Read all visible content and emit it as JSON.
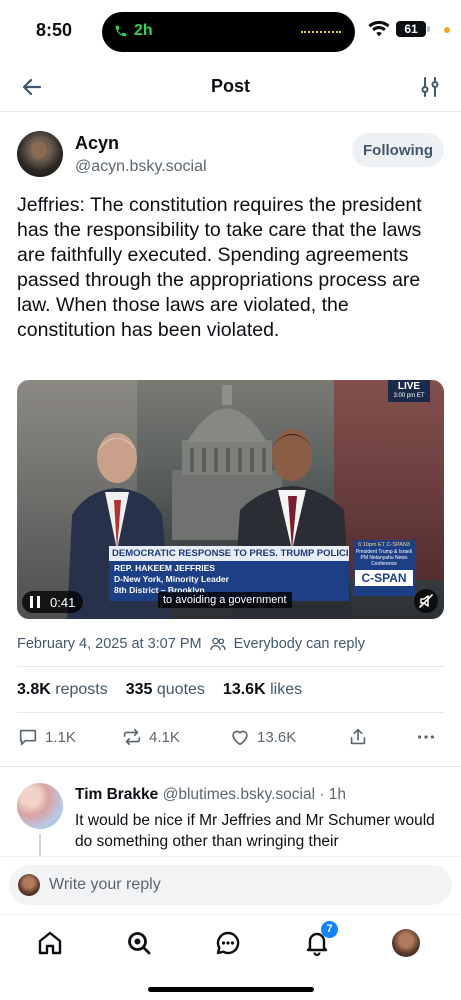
{
  "status_bar": {
    "time": "8:50",
    "call_duration": "2h",
    "battery": "61"
  },
  "header": {
    "title": "Post"
  },
  "post": {
    "author_name": "Acyn",
    "author_handle": "@acyn.bsky.social",
    "follow_state": "Following",
    "text": "Jeffries: The constitution requires the president has the responsibility to take care that the laws are faithfully executed. Spending agreements passed through the appropriations process are law. When those laws are violated, the constitution has been violated.",
    "video": {
      "live_label": "LIVE",
      "live_time": "3:00 pm ET",
      "chyron_headline": "DEMOCRATIC RESPONSE TO PRES. TRUMP POLICIES",
      "chyron_name": "REP. HAKEEM JEFFRIES",
      "chyron_role": "D-New York, Minority Leader",
      "chyron_district": "8th District – Brooklyn",
      "side_time": "6:10pm ET C-SPAN3",
      "side_text": "President Trump & Israeli PM Netanyahu News Conference",
      "network": "C-SPAN",
      "elapsed": "0:41",
      "caption": "to avoiding a government"
    },
    "date": "February 4, 2025 at 3:07 PM",
    "reply_setting": "Everybody can reply",
    "stats": {
      "reposts_count": "3.8K",
      "reposts_label": "reposts",
      "quotes_count": "335",
      "quotes_label": "quotes",
      "likes_count": "13.6K",
      "likes_label": "likes"
    },
    "actions": {
      "replies": "1.1K",
      "reposts": "4.1K",
      "likes": "13.6K"
    }
  },
  "reply": {
    "name": "Tim Brakke",
    "handle": "@blutimes.bsky.social",
    "time": "· 1h",
    "text": "It would be nice if Mr Jeffries and Mr Schumer would do something other than wringing their"
  },
  "composer": {
    "placeholder": "Write your reply"
  },
  "nav": {
    "notifications_badge": "7"
  },
  "colors": {
    "accent": "#1083fe",
    "muted": "#42576c",
    "divider": "#e6e9ec"
  }
}
